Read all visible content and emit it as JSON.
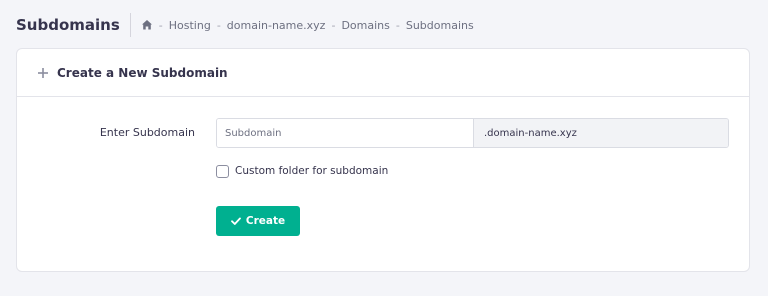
{
  "header": {
    "title": "Subdomains",
    "breadcrumb": {
      "home_icon": "home-icon",
      "items": [
        "Hosting",
        "domain-name.xyz",
        "Domains",
        "Subdomains"
      ],
      "separator": "-"
    }
  },
  "card": {
    "icon": "plus-icon",
    "title": "Create a New Subdomain",
    "form": {
      "label": "Enter Subdomain",
      "input_value": "",
      "input_placeholder": "Subdomain",
      "suffix": ".domain-name.xyz",
      "checkbox_label": "Custom folder for subdomain",
      "checkbox_checked": false,
      "button_label": "Create",
      "button_icon": "check-icon"
    }
  },
  "colors": {
    "background": "#f4f5f9",
    "accent": "#00b090",
    "text": "#36344d",
    "muted": "#6d7081"
  }
}
